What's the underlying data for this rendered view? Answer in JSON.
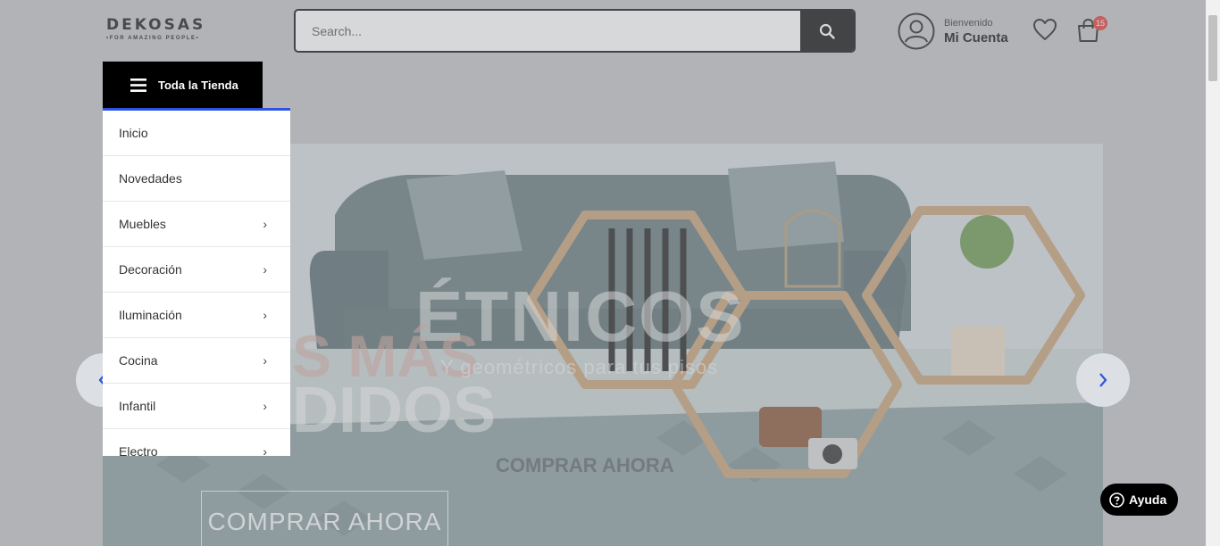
{
  "header": {
    "logo": {
      "name": "DEKOSAS",
      "tagline": "•FOR AMAZING PEOPLE•"
    },
    "search": {
      "placeholder": "Search...",
      "button_icon": "search-icon"
    },
    "account": {
      "welcome": "Bienvenido",
      "label": "Mi Cuenta",
      "icon": "user-icon"
    },
    "wishlist_icon": "heart-icon",
    "cart": {
      "icon": "shopping-bag-icon",
      "count": "15"
    }
  },
  "categories": {
    "button_label": "Toda la Tienda",
    "items": [
      {
        "label": "Inicio",
        "has_submenu": false
      },
      {
        "label": "Novedades",
        "has_submenu": false
      },
      {
        "label": "Muebles",
        "has_submenu": true
      },
      {
        "label": "Decoración",
        "has_submenu": true
      },
      {
        "label": "Iluminación",
        "has_submenu": true
      },
      {
        "label": "Cocina",
        "has_submenu": true
      },
      {
        "label": "Infantil",
        "has_submenu": true
      },
      {
        "label": "Electro",
        "has_submenu": true
      }
    ]
  },
  "hero": {
    "title_line_1": "ÉTNICOS",
    "title_line_2": "S MÁS",
    "subtitle": "Y geométricos para tus pisos",
    "title_line_3": "DIDOS",
    "cta_small": "COMPRAR AHORA",
    "cta_big": "COMPRAR AHORA"
  },
  "help": {
    "label": "Ayuda"
  },
  "colors": {
    "accent": "#2f52e0",
    "badge": "#e53b3b",
    "dark": "#000000"
  }
}
